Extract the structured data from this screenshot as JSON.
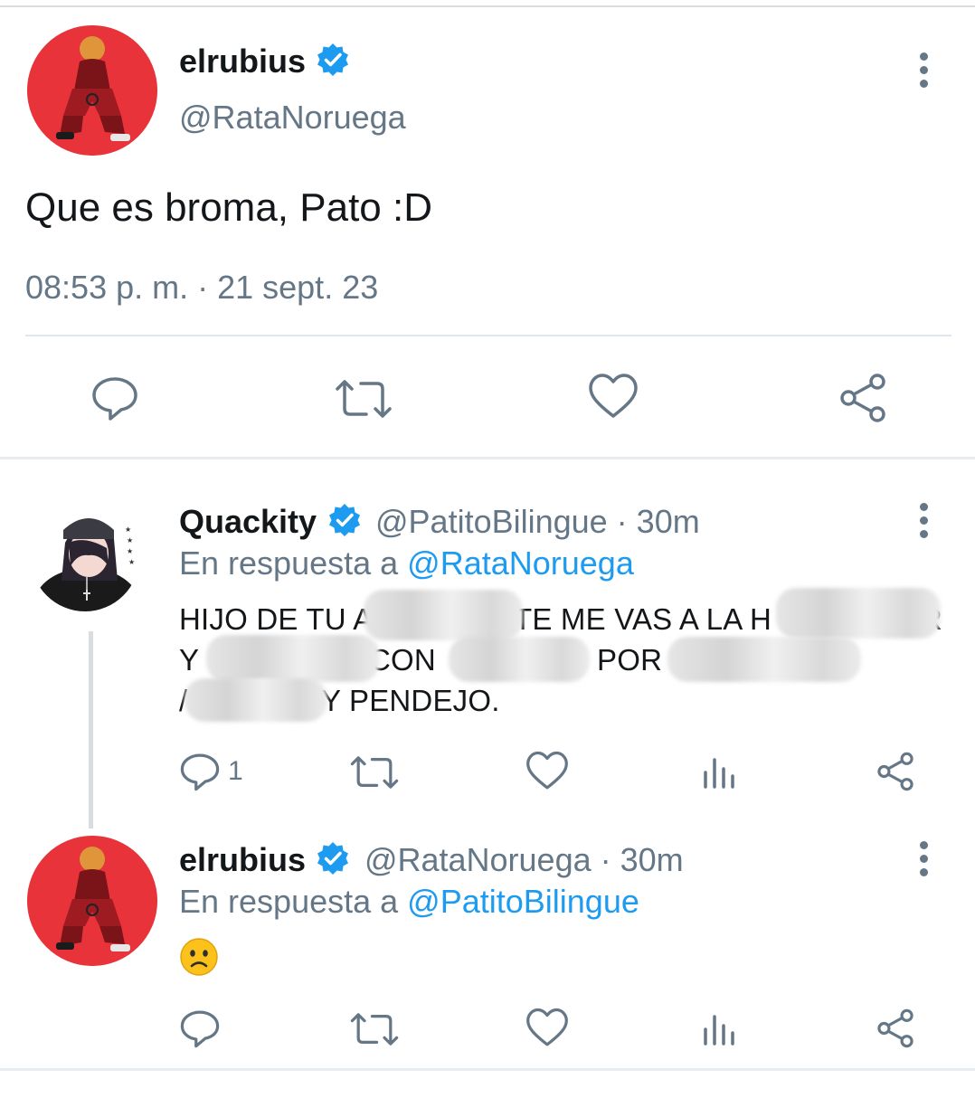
{
  "main_tweet": {
    "name": "elrubius",
    "handle": "@RataNoruega",
    "text": "Que es broma, Pato :D",
    "timestamp": "08:53 p. m. · 21 sept. 23",
    "actions": [
      "comment-icon",
      "retweet-icon",
      "like-icon",
      "share-icon"
    ]
  },
  "replies": [
    {
      "name": "Quackity",
      "handle_time": "@PatitoBilingue · 30m",
      "reply_prefix": "En respuesta a",
      "reply_mention": "@RataNoruega",
      "text_line1_a": "HIJO DE TU A",
      "text_line1_b": "TE ME VAS A LA H",
      "text_line1_c": "R",
      "text_line2_a": "Y",
      "text_line2_b": "CON",
      "text_line2_c": "POR",
      "text_line3_a": "/",
      "text_line3_b": "Y PENDEJO.",
      "reply_count": "1"
    },
    {
      "name": "elrubius",
      "handle_time": "@RataNoruega · 30m",
      "reply_prefix": "En respuesta a",
      "reply_mention": "@PatitoBilingue",
      "emoji": "😦"
    }
  ],
  "colors": {
    "accent": "#1d9bf0",
    "secondary_text": "#657786",
    "divider": "#e1e8ed",
    "avatar_red": "#e8333a"
  }
}
